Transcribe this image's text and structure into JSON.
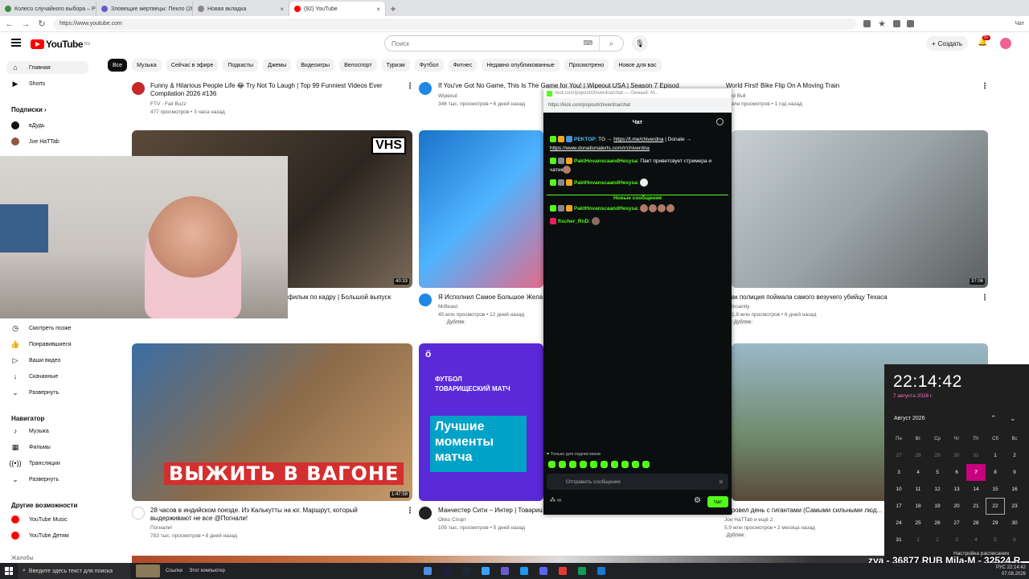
{
  "browser": {
    "tabs": [
      {
        "label": "Колесо случайного выбора – Pic",
        "color": "#3c8c3c",
        "active": false
      },
      {
        "label": "Зловещие мертвецы: Пекло (202",
        "color": "#6a5acd",
        "active": false
      },
      {
        "label": "Новая вкладка",
        "color": "#888888",
        "active": false
      },
      {
        "label": "(92) YouTube",
        "color": "#ff0000",
        "active": true
      }
    ],
    "url": "https://www.youtube.com",
    "profile_label": "Чат"
  },
  "youtube": {
    "logo_text": "YouTube",
    "logo_region": "RU",
    "search_placeholder": "Поиск",
    "create_label": "Создать",
    "notif_count": "9+",
    "chips": [
      "Все",
      "Музыка",
      "Сейчас в эфире",
      "Подкасты",
      "Джемы",
      "Видеоигры",
      "Велоспорт",
      "Туризм",
      "Футбол",
      "Фитнес",
      "Недавно опубликованные",
      "Просмотрено",
      "Новое для вас"
    ],
    "sidebar": {
      "main": [
        {
          "label": "Главная",
          "icon": "home-icon"
        },
        {
          "label": "Shorts",
          "icon": "shorts-icon"
        }
      ],
      "subs_header": "Подписки",
      "subs": [
        {
          "label": "вДудь"
        },
        {
          "label": "Joe HaTTab"
        }
      ],
      "you": [
        {
          "label": "Смотреть позже",
          "icon": "clock-icon"
        },
        {
          "label": "Понравившиеся",
          "icon": "like-icon"
        },
        {
          "label": "Ваши видео",
          "icon": "video-icon"
        },
        {
          "label": "Скачанные",
          "icon": "download-icon"
        },
        {
          "label": "Развернуть",
          "icon": "chevron-down-icon"
        }
      ],
      "nav_header": "Навигатор",
      "nav": [
        {
          "label": "Музыка",
          "icon": "music-icon"
        },
        {
          "label": "Фильмы",
          "icon": "film-icon"
        },
        {
          "label": "Трансляции",
          "icon": "live-icon"
        },
        {
          "label": "Развернуть",
          "icon": "chevron-down-icon"
        }
      ],
      "more_header": "Другие возможности",
      "more": [
        {
          "label": "YouTube Music"
        },
        {
          "label": "YouTube Детям"
        }
      ],
      "cut_label": "Жалобы"
    },
    "videos_row1": [
      {
        "title": "Funny & Hilarious People Life 😂 Try Not To Laugh | Top 99 Funniest Videos Ever Compilation 2026 #136",
        "channel": "FTV - Fail Buzz",
        "meta": "477 просмотров • 3 часа назад"
      },
      {
        "title": "If You've Got No Game, This Is The Game for You! | Wipeout USA | Season 7 Episode 1",
        "channel": "Wipeout",
        "meta": "346 тыс. просмотров • 6 дней назад"
      },
      {
        "title": "World First! Bike Flip On A Moving Train",
        "channel": "Red Bull",
        "meta": "5 млн просмотров • 1 год назад"
      }
    ],
    "videos_row2": [
      {
        "title": "фильм по кадру | Большой выпуск",
        "duration": "40:33",
        "badge": "VHS"
      },
      {
        "title": "Я Исполнил Самое Большое Жела...",
        "channel": "MrBeast",
        "meta": "45 млн просмотров • 12 дней назад",
        "dub": "Дубляж"
      },
      {
        "title": "...ак полиция поймала самого везучего убийцу Техаса",
        "channel": "Insanity",
        "meta": "1,9 млн просмотров • 6 дней назад",
        "dub": "Дубляж",
        "duration": "37:06"
      }
    ],
    "videos_row3": [
      {
        "title": "28 часов в индийском поезде. Из Калькутты на юг. Маршрут, который выдерживают не все @Погнали!",
        "channel": "Погнали!",
        "meta": "783 тыс. просмотров • 8 дней назад",
        "duration": "1:47:59",
        "overlay": "ВЫЖИТЬ В ВАГОНЕ"
      },
      {
        "title": "Манчестер Сити – Интер | Товарищ...",
        "channel": "Okko Спорт",
        "meta": "109 тыс. просмотров • 5 дней назад",
        "tag1": "ФУТБОЛ",
        "tag2": "ТОВАРИЩЕСКИЙ МАТЧ",
        "big": "Лучшие моменты матча"
      },
      {
        "title": "...ровел день с гигантами (Самыми сильными люд...",
        "channel": "Joe HaTTab и ещё 2",
        "meta": "5,9 млн просмотров • 2 месяца назад",
        "dub": "Дубляж"
      }
    ]
  },
  "chat": {
    "win_title": "kick.com/popout/chiverdna/chat — Личный: M...",
    "url": "https://kick.com/popout/chiverdna/chat",
    "header": "Чат",
    "pinned": {
      "user": "PEKTOP",
      "text": ": TG → ",
      "link1": "https://t.me/chiverdna",
      "mid": " | Donate → ",
      "link2": "https://www.donationalerts.com/r/chiverdna"
    },
    "messages": [
      {
        "user": "PaktHovanscaandHesysa",
        "text": ": Пакт приветсвует стримера и чатик"
      },
      {
        "user": "PaktHovanscaandHesysa",
        "text": ":"
      }
    ],
    "new_label": "Новые сообщения",
    "new_messages": [
      {
        "user": "PaktHovanscaandHesysa",
        "text": ":"
      },
      {
        "user": "fischer_RnD",
        "text": ":"
      }
    ],
    "subs_only": "Только для подписчиков",
    "input_placeholder": "Отправить сообщение",
    "send_label": "Чат",
    "points": "∞"
  },
  "clock": {
    "time": "22:14:42",
    "date": "7 августа 2026 г.",
    "month": "Август 2026",
    "weekdays": [
      "Пн",
      "Вт",
      "Ср",
      "Чт",
      "Пт",
      "Сб",
      "Вс"
    ],
    "days": [
      [
        "27",
        "28",
        "29",
        "30",
        "31",
        "1",
        "2"
      ],
      [
        "3",
        "4",
        "5",
        "6",
        "7",
        "8",
        "9"
      ],
      [
        "10",
        "11",
        "12",
        "13",
        "14",
        "15",
        "16"
      ],
      [
        "17",
        "18",
        "19",
        "20",
        "21",
        "22",
        "23"
      ],
      [
        "24",
        "25",
        "26",
        "27",
        "28",
        "29",
        "30"
      ],
      [
        "31",
        "1",
        "2",
        "3",
        "4",
        "5",
        "6"
      ]
    ],
    "today": "7",
    "schedule_label": "Настройка расписания"
  },
  "donation": "zya - 36877 RUB  Mila-M - 32524 R",
  "taskbar": {
    "search_placeholder": "Введите здесь текст для поиска",
    "links": "Ссылки",
    "computer": "Этот компьютер",
    "lang": "РУС",
    "time": "22:14:42",
    "date": "07.08.2026"
  }
}
